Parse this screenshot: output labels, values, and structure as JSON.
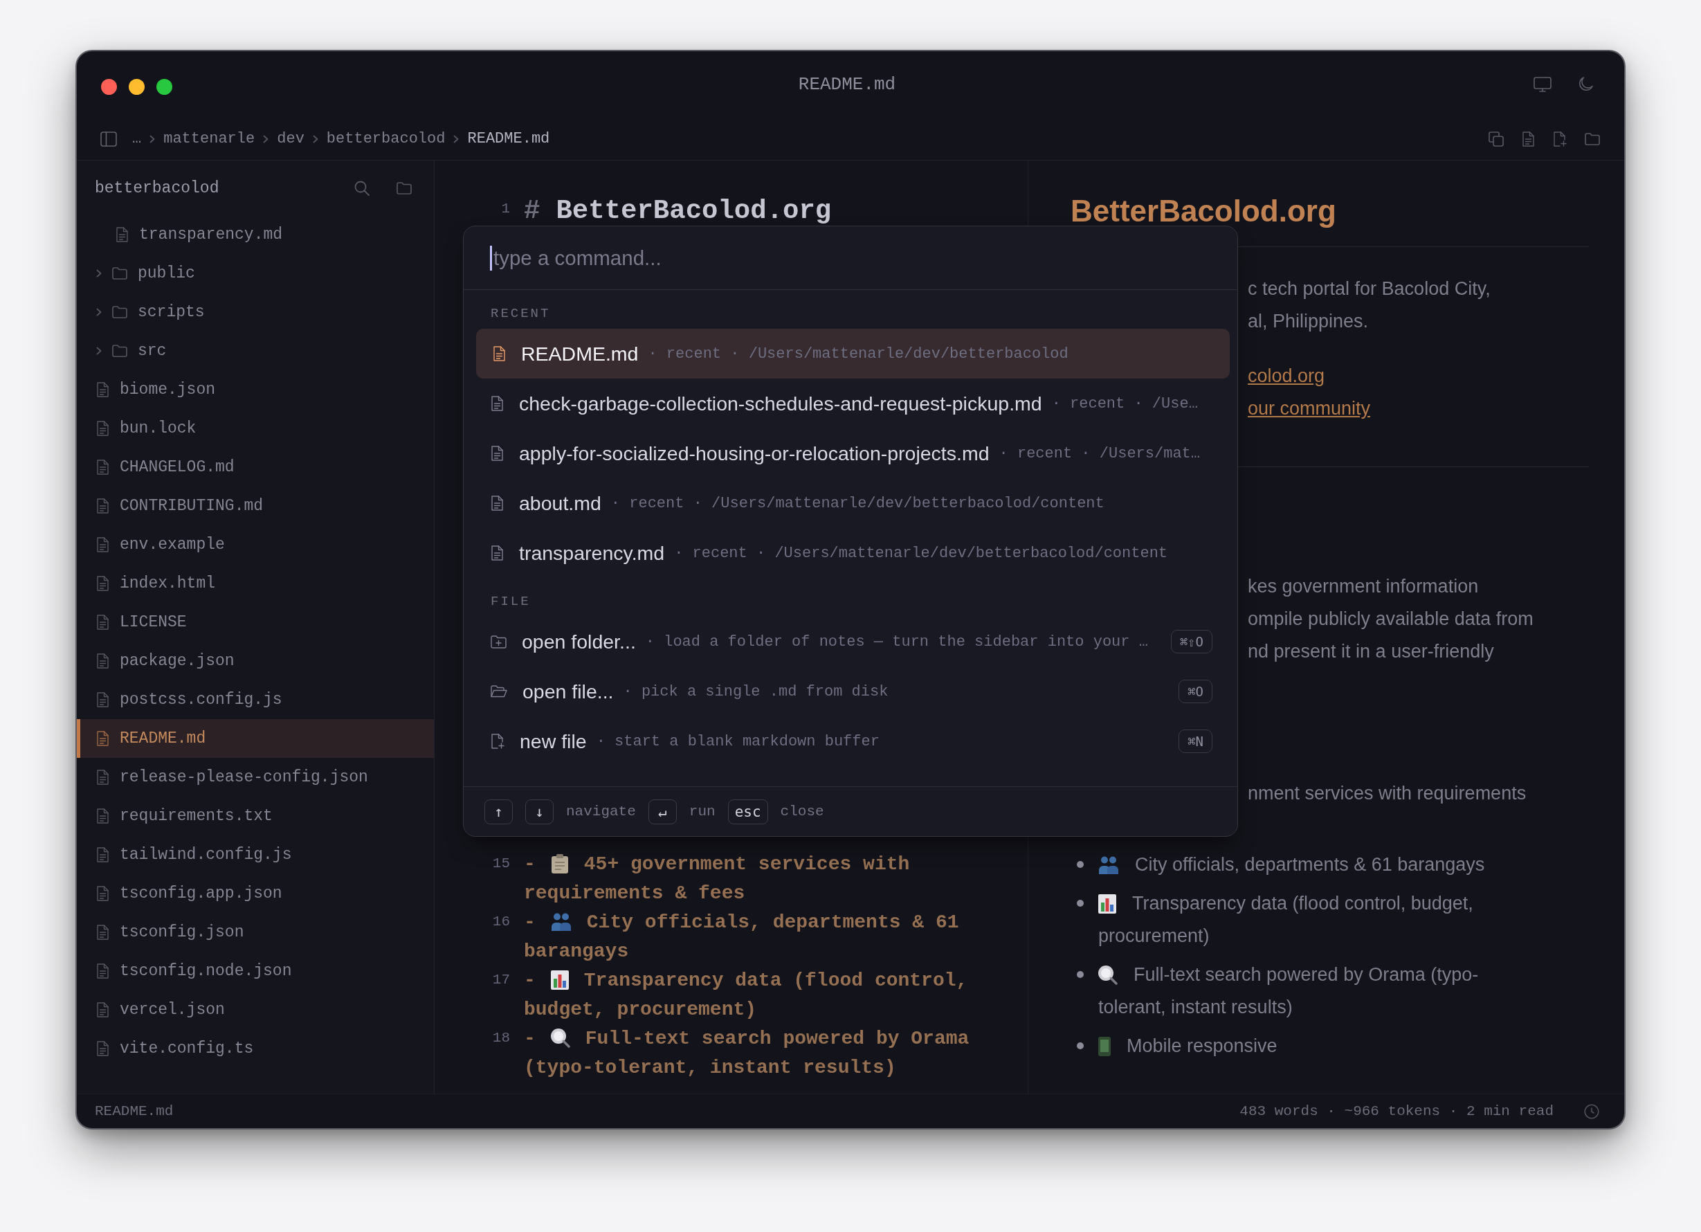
{
  "window": {
    "title": "README.md"
  },
  "toolbar": {
    "breadcrumb": [
      "…",
      "mattenarle",
      "dev",
      "betterbacolod",
      "README.md"
    ]
  },
  "sidebar": {
    "title": "betterbacolod",
    "items": [
      {
        "kind": "group",
        "children": [
          {
            "kind": "file",
            "name": "transparency.md",
            "selected": false
          }
        ]
      },
      {
        "kind": "folder",
        "name": "public",
        "expanded": false,
        "selected": false
      },
      {
        "kind": "folder",
        "name": "scripts",
        "expanded": false,
        "selected": false
      },
      {
        "kind": "folder",
        "name": "src",
        "expanded": false,
        "selected": false
      },
      {
        "kind": "file",
        "name": "biome.json",
        "selected": false
      },
      {
        "kind": "file",
        "name": "bun.lock",
        "selected": false
      },
      {
        "kind": "file",
        "name": "CHANGELOG.md",
        "selected": false
      },
      {
        "kind": "file",
        "name": "CONTRIBUTING.md",
        "selected": false
      },
      {
        "kind": "file",
        "name": "env.example",
        "selected": false
      },
      {
        "kind": "file",
        "name": "index.html",
        "selected": false
      },
      {
        "kind": "file",
        "name": "LICENSE",
        "selected": false
      },
      {
        "kind": "file",
        "name": "package.json",
        "selected": false
      },
      {
        "kind": "file",
        "name": "postcss.config.js",
        "selected": false
      },
      {
        "kind": "file",
        "name": "README.md",
        "selected": true
      },
      {
        "kind": "file",
        "name": "release-please-config.json",
        "selected": false
      },
      {
        "kind": "file",
        "name": "requirements.txt",
        "selected": false
      },
      {
        "kind": "file",
        "name": "tailwind.config.js",
        "selected": false
      },
      {
        "kind": "file",
        "name": "tsconfig.app.json",
        "selected": false
      },
      {
        "kind": "file",
        "name": "tsconfig.json",
        "selected": false
      },
      {
        "kind": "file",
        "name": "tsconfig.node.json",
        "selected": false
      },
      {
        "kind": "file",
        "name": "vercel.json",
        "selected": false
      },
      {
        "kind": "file",
        "name": "vite.config.ts",
        "selected": false
      }
    ]
  },
  "editor": {
    "lines": [
      {
        "number": "1",
        "kind": "heading",
        "marker": "#",
        "rows": [
          "BetterBacolod.org"
        ]
      },
      {
        "number": "15",
        "kind": "bullet",
        "marker": "-",
        "rows": [
          "45+ government services with",
          "requirements & fees"
        ]
      },
      {
        "number": "16",
        "kind": "bullet",
        "marker": "-",
        "rows": [
          "City officials, departments & 61",
          "barangays"
        ]
      },
      {
        "number": "17",
        "kind": "bullet",
        "marker": "-",
        "rows": [
          "Transparency data (flood control,",
          "budget, procurement)"
        ]
      },
      {
        "number": "18",
        "kind": "bullet",
        "marker": "-",
        "rows": [
          "Full-text search powered by Orama",
          "(typo-tolerant, instant results)"
        ]
      }
    ]
  },
  "preview": {
    "title": "BetterBacolod.org",
    "intro": [
      "c tech portal for Bacolod City,",
      "al, Philippines."
    ],
    "links": [
      "colod.org",
      "our community"
    ],
    "about": [
      "kes government information",
      "ompile publicly available data from",
      "nd present it in a user-friendly"
    ],
    "features_intro": "nment services with requirements",
    "features": [
      {
        "rows": [
          "City officials, departments & 61 barangays"
        ]
      },
      {
        "rows": [
          "Transparency data (flood control, budget,",
          "procurement)"
        ]
      },
      {
        "rows": [
          "Full-text search powered by Orama (typo-",
          "tolerant, instant results)"
        ]
      },
      {
        "rows": [
          "Mobile responsive"
        ]
      }
    ]
  },
  "status_bar": {
    "file": "README.md",
    "stats": "483 words · ~966 tokens · 2 min read"
  },
  "palette": {
    "placeholder": "type a command...",
    "sections": [
      {
        "label": "RECENT",
        "items": [
          {
            "kind": "recent",
            "name": "README.md",
            "detail": "· recent · /Users/mattenarle/dev/betterbacolod",
            "selected": true
          },
          {
            "kind": "recent",
            "name": "check-garbage-collection-schedules-and-request-pickup.md",
            "detail": "· recent · /Use…",
            "selected": false
          },
          {
            "kind": "recent",
            "name": "apply-for-socialized-housing-or-relocation-projects.md",
            "detail": "· recent · /Users/mat…",
            "selected": false
          },
          {
            "kind": "recent",
            "name": "about.md",
            "detail": "· recent · /Users/mattenarle/dev/betterbacolod/content",
            "selected": false
          },
          {
            "kind": "recent",
            "name": "transparency.md",
            "detail": "· recent · /Users/mattenarle/dev/betterbacolod/content",
            "selected": false
          }
        ]
      },
      {
        "label": "FILE",
        "items": [
          {
            "kind": "open-folder",
            "name": "open folder...",
            "detail": "· load a folder of notes — turn the sidebar into your …",
            "shortcut": "⌘⇧O",
            "selected": false
          },
          {
            "kind": "open-file",
            "name": "open file...",
            "detail": "· pick a single .md from disk",
            "shortcut": "⌘O",
            "selected": false
          },
          {
            "kind": "new-file",
            "name": "new file",
            "detail": "· start a blank markdown buffer",
            "shortcut": "⌘N",
            "selected": false
          }
        ]
      }
    ],
    "hints": [
      {
        "keys": [
          "↑",
          "↓"
        ],
        "label": "navigate"
      },
      {
        "keys": [
          "↵"
        ],
        "label": "run"
      },
      {
        "keys": [
          "esc"
        ],
        "label": "close"
      }
    ]
  }
}
